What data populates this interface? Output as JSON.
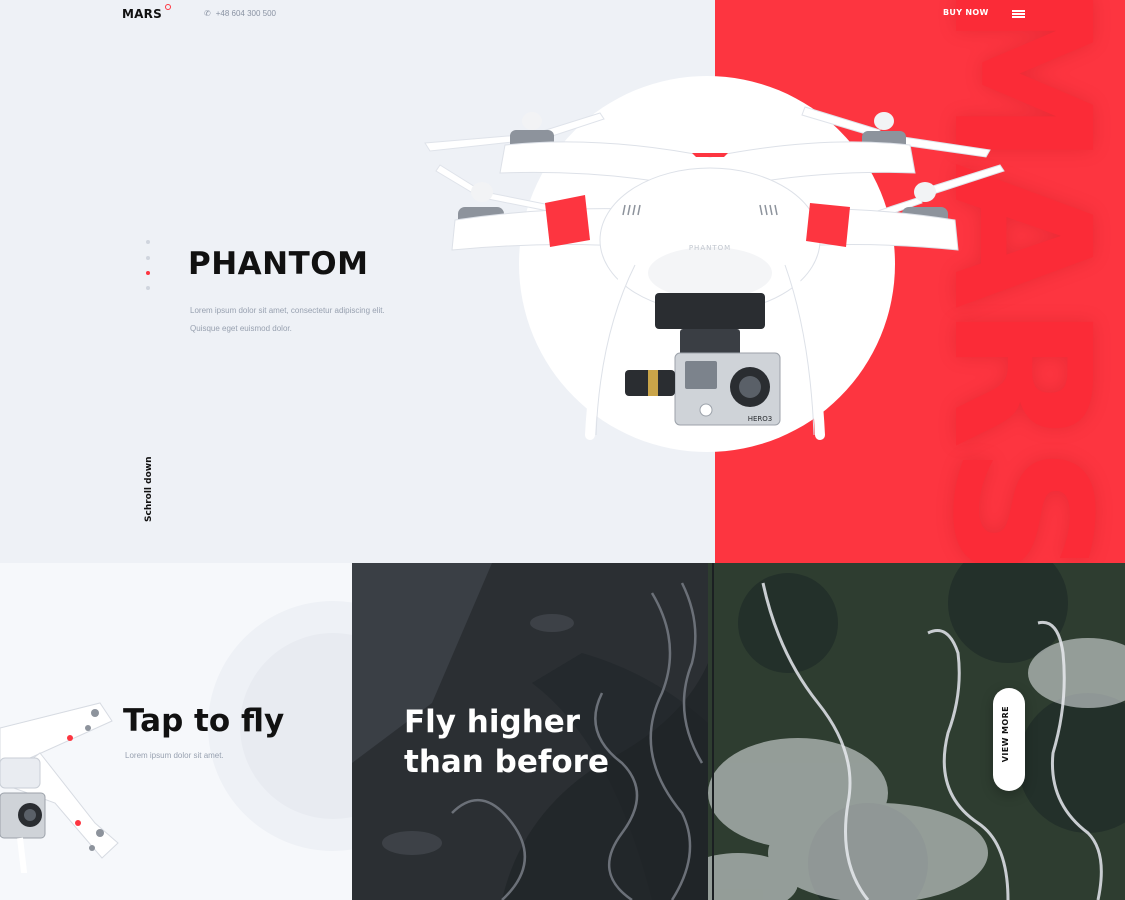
{
  "header": {
    "logo": "MARS",
    "phone": "+48 604 300 500",
    "buy_now": "BUY NOW",
    "menu_icon": "hamburger-menu-icon"
  },
  "hero": {
    "title": "PHANTOM",
    "description_line1": "Lorem ipsum dolor sit amet, consectetur adipiscing elit.",
    "description_line2": "Quisque eget euismod dolor.",
    "scroll_label": "Schroll down",
    "background_word": "MARS",
    "pager": {
      "count": 4,
      "active_index": 2
    },
    "drone_brand": "PHANTOM",
    "camera_label": "HERO3"
  },
  "panels": {
    "left": {
      "title": "Tap to fly",
      "description": "Lorem ipsum dolor sit amet."
    },
    "middle": {
      "title_line1": "Fly higher",
      "title_line2": "than before"
    },
    "right": {
      "button": "VIEW MORE"
    }
  },
  "colors": {
    "accent_red": "#fd3540",
    "hero_bg": "#eef1f6",
    "text_dark": "#111111",
    "text_muted": "#98a1b0"
  }
}
